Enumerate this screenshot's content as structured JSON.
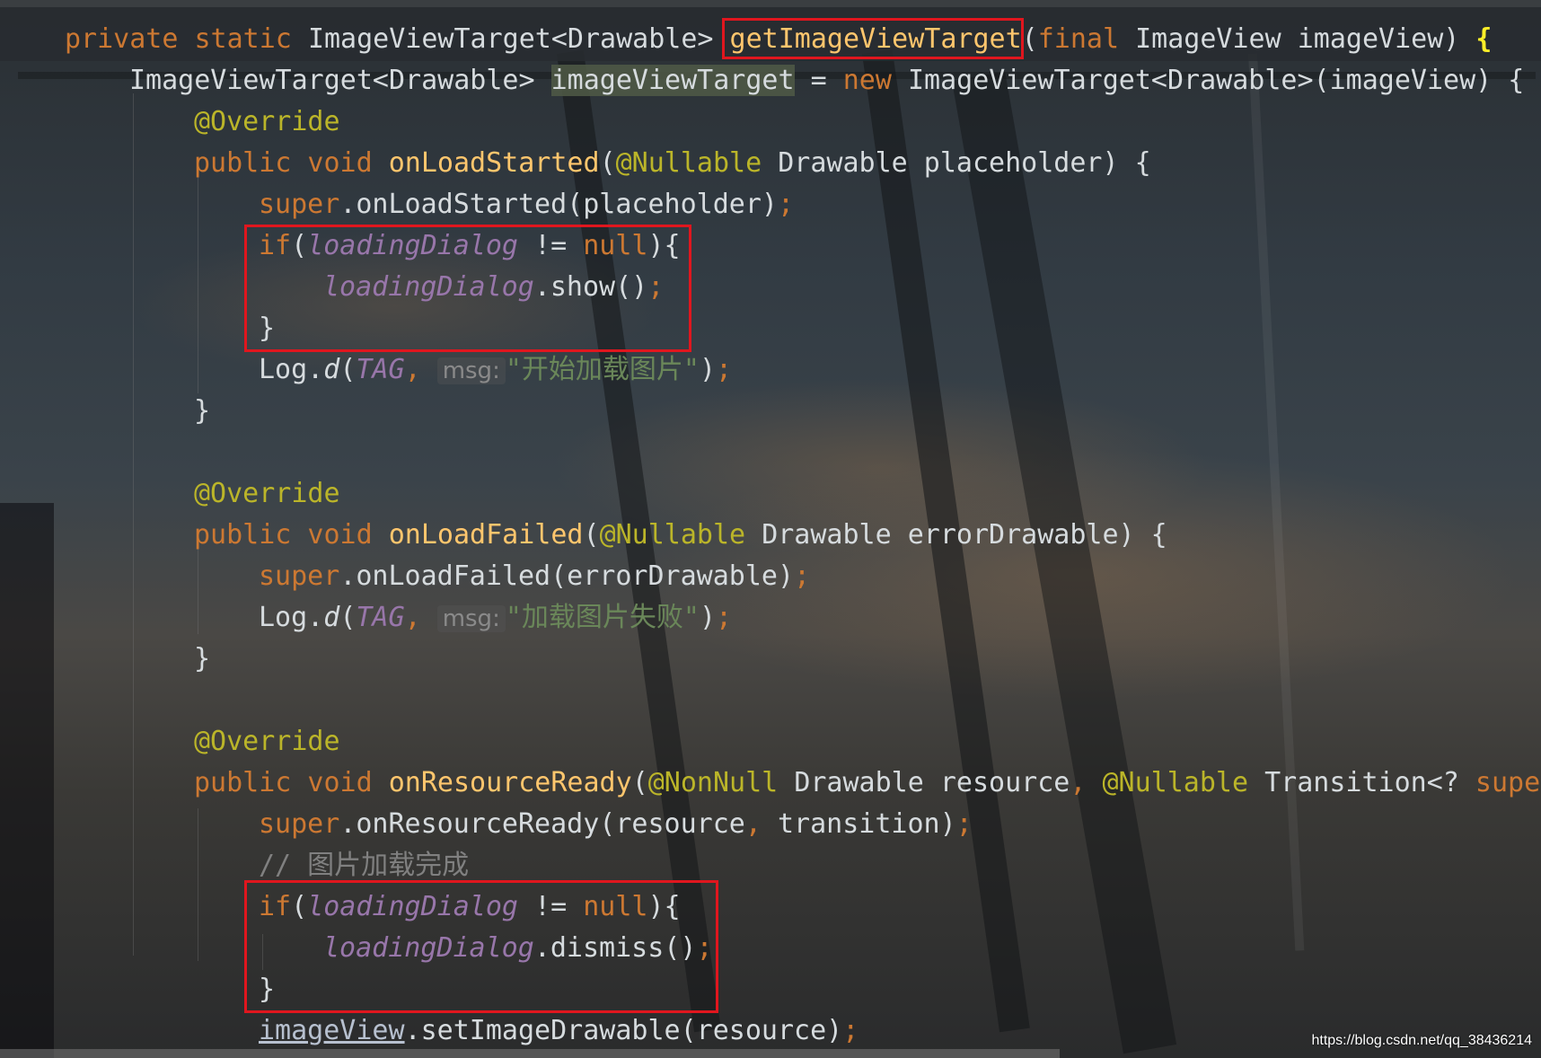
{
  "lines": {
    "l0": {
      "a": "private static ",
      "b": "ImageViewTarget<Drawable> ",
      "c": "getImageViewTarget",
      "d": "(",
      "e": "final ",
      "f": "ImageView imageView) ",
      "g": "{"
    },
    "l1": {
      "a": "ImageViewTarget<Drawable> ",
      "b": "imageViewTarget",
      "c": " = ",
      "d": "new ",
      "e": "ImageViewTarget<Drawable>(imageView) {"
    },
    "l2": {
      "a": "@Override"
    },
    "l3": {
      "a": "public void ",
      "b": "onLoadStarted",
      "c": "(",
      "d": "@Nullable ",
      "e": "Drawable placeholder) {"
    },
    "l4": {
      "a": "super",
      "b": ".onLoadStarted(placeholder)",
      "c": ";"
    },
    "l5": {
      "a": "if",
      "b": "(",
      "c": "loadingDialog",
      "d": " != ",
      "e": "null",
      "f": "){"
    },
    "l6": {
      "a": "loadingDialog",
      "b": ".show()",
      "c": ";"
    },
    "l7": {
      "a": "}"
    },
    "l8": {
      "a": "Log.",
      "b": "d",
      "c": "(",
      "d": "TAG",
      "e": ", ",
      "f": "msg:",
      "g": "\"开始加载图片\"",
      "h": ")",
      "i": ";"
    },
    "l9": {
      "a": "}"
    },
    "l11": {
      "a": "@Override"
    },
    "l12": {
      "a": "public void ",
      "b": "onLoadFailed",
      "c": "(",
      "d": "@Nullable ",
      "e": "Drawable errorDrawable) {"
    },
    "l13": {
      "a": "super",
      "b": ".onLoadFailed(errorDrawable)",
      "c": ";"
    },
    "l14": {
      "a": "Log.",
      "b": "d",
      "c": "(",
      "d": "TAG",
      "e": ", ",
      "f": "msg:",
      "g": "\"加载图片失败\"",
      "h": ")",
      "i": ";"
    },
    "l15": {
      "a": "}"
    },
    "l17": {
      "a": "@Override"
    },
    "l18": {
      "a": "public void ",
      "b": "onResourceReady",
      "c": "(",
      "d": "@NonNull ",
      "e": "Drawable resource",
      "f": ", ",
      "g": "@Nullable ",
      "h": "Transition<? ",
      "i": "super"
    },
    "l19": {
      "a": "super",
      "b": ".onResourceReady(resource",
      "c": ", ",
      "d": "transition)",
      "e": ";"
    },
    "l20": {
      "a": "// 图片加载完成"
    },
    "l21": {
      "a": "if",
      "b": "(",
      "c": "loadingDialog",
      "d": " != ",
      "e": "null",
      "f": "){"
    },
    "l22": {
      "a": "loadingDialog",
      "b": ".dismiss()",
      "c": ";"
    },
    "l23": {
      "a": "}"
    },
    "l24": {
      "a": "imageView",
      "b": ".setImageDrawable(resource)",
      "c": ";"
    }
  },
  "watermark": "https://blog.csdn.net/qq_38436214",
  "colors": {
    "keyword": "#cc7832",
    "annotation": "#bbb529",
    "function": "#ffc66d",
    "field": "#9876aa",
    "string": "#6a8759",
    "comment": "#808080",
    "default_text": "#d6dbde",
    "highlight_box": "#e0161e"
  }
}
